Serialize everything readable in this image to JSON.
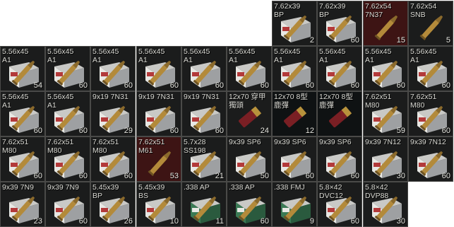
{
  "inventory": {
    "rows": [
      [
        {
          "name": "7.62x39\nBP",
          "qty": "2",
          "art": "box-with-cartridge-icon",
          "tint": "normal"
        },
        {
          "name": "7.62x39\nBP",
          "qty": "60",
          "art": "box-with-cartridge-icon",
          "tint": "normal"
        },
        {
          "name": "7.62x54\n7N37",
          "qty": "15",
          "art": "cartridge-icon",
          "tint": "red"
        },
        {
          "name": "7.62x54\nSNB",
          "qty": "5",
          "art": "cartridge-icon",
          "tint": "normal"
        }
      ],
      [
        {
          "name": "5.56x45\nA1",
          "qty": "54",
          "art": "box-with-cartridge-icon",
          "tint": "normal"
        },
        {
          "name": "5.56x45\nA1",
          "qty": "60",
          "art": "box-with-cartridge-icon",
          "tint": "normal"
        },
        {
          "name": "5.56x45\nA1",
          "qty": "60",
          "art": "box-with-cartridge-icon",
          "tint": "normal"
        },
        {
          "name": "5.56x45\nA1",
          "qty": "60",
          "art": "box-with-cartridge-icon",
          "tint": "normal"
        },
        {
          "name": "5.56x45\nA1",
          "qty": "60",
          "art": "box-with-cartridge-icon",
          "tint": "normal"
        },
        {
          "name": "5.56x45\nA1",
          "qty": "60",
          "art": "box-with-cartridge-icon",
          "tint": "normal"
        },
        {
          "name": "5.56x45\nA1",
          "qty": "60",
          "art": "box-with-cartridge-icon",
          "tint": "normal"
        },
        {
          "name": "5.56x45\nA1",
          "qty": "60",
          "art": "box-with-cartridge-icon",
          "tint": "normal"
        },
        {
          "name": "5.56x45\nA1",
          "qty": "60",
          "art": "box-with-cartridge-icon",
          "tint": "normal"
        },
        {
          "name": "5.56x45\nA1",
          "qty": "60",
          "art": "box-with-cartridge-icon",
          "tint": "normal"
        }
      ],
      [
        {
          "name": "5.56x45\nA1",
          "qty": "60",
          "art": "box-with-cartridge-icon",
          "tint": "normal"
        },
        {
          "name": "5.56x45\nA1",
          "qty": "60",
          "art": "box-with-cartridge-icon",
          "tint": "normal"
        },
        {
          "name": "9x19 7N31",
          "qty": "29",
          "art": "box-with-cartridge-icon",
          "tint": "normal"
        },
        {
          "name": "9x19 7N31",
          "qty": "60",
          "art": "box-with-cartridge-icon",
          "tint": "normal"
        },
        {
          "name": "9x19 7N31",
          "qty": "60",
          "art": "box-with-cartridge-icon",
          "tint": "normal"
        },
        {
          "name": "12x70 穿甲\n獨頭",
          "qty": "24",
          "art": "shotgun-shell-icon",
          "tint": "normal"
        },
        {
          "name": "12x70 8型\n鹿彈",
          "qty": "12",
          "art": "shotgun-shell-icon",
          "tint": "dark"
        },
        {
          "name": "12x70 8型\n鹿彈",
          "qty": "",
          "art": "shotgun-shell-icon",
          "tint": "dark"
        },
        {
          "name": "7.62x51\nM80",
          "qty": "59",
          "art": "box-with-cartridge-icon",
          "tint": "normal"
        },
        {
          "name": "7.62x51\nM80",
          "qty": "60",
          "art": "box-with-cartridge-icon",
          "tint": "normal"
        }
      ],
      [
        {
          "name": "7.62x51\nM80",
          "qty": "60",
          "art": "box-with-cartridge-icon",
          "tint": "normal"
        },
        {
          "name": "7.62x51\nM80",
          "qty": "60",
          "art": "box-with-cartridge-icon",
          "tint": "normal"
        },
        {
          "name": "7.62x51\nM80",
          "qty": "60",
          "art": "box-with-cartridge-icon",
          "tint": "normal"
        },
        {
          "name": "7.62x51\nM61",
          "qty": "53",
          "art": "cartridge-icon",
          "tint": "red"
        },
        {
          "name": "5.7x28\nSS198",
          "qty": "21",
          "art": "box-with-cartridge-icon",
          "tint": "normal"
        },
        {
          "name": "9x39 SP6",
          "qty": "50",
          "art": "box-with-cartridge-icon",
          "tint": "normal"
        },
        {
          "name": "9x39 SP6",
          "qty": "60",
          "art": "box-with-cartridge-icon",
          "tint": "normal"
        },
        {
          "name": "9x39 SP6",
          "qty": "60",
          "art": "box-with-cartridge-icon",
          "tint": "normal"
        },
        {
          "name": "9x39 7N12",
          "qty": "30",
          "art": "box-with-cartridge-icon",
          "tint": "normal"
        },
        {
          "name": "9x39 7N12",
          "qty": "60",
          "art": "box-with-cartridge-icon",
          "tint": "normal"
        }
      ],
      [
        {
          "name": "9x39 7N9",
          "qty": "23",
          "art": "box-with-cartridge-icon",
          "tint": "normal"
        },
        {
          "name": "9x39 7N9",
          "qty": "60",
          "art": "box-with-cartridge-icon",
          "tint": "normal"
        },
        {
          "name": "5.45x39\nBP",
          "qty": "26",
          "art": "box-with-cartridge-icon",
          "tint": "normal"
        },
        {
          "name": "5.45x39\nBS",
          "qty": "10",
          "art": "box-with-cartridge-icon",
          "tint": "normal"
        },
        {
          "name": ".338 AP",
          "qty": "11",
          "art": "green-box-icon",
          "tint": "normal"
        },
        {
          "name": ".338 AP",
          "qty": "60",
          "art": "green-box-icon",
          "tint": "normal"
        },
        {
          "name": ".338 FMJ",
          "qty": "9",
          "art": "green-box-icon",
          "tint": "normal"
        },
        {
          "name": "5.8×42\nDVC12",
          "qty": "60",
          "art": "box-with-cartridge-icon",
          "tint": "normal"
        },
        {
          "name": "5.8×42\nDVP88",
          "qty": "30",
          "art": "box-with-cartridge-icon",
          "tint": "normal"
        }
      ]
    ]
  },
  "colors": {
    "cell_bg": "#1b1c1c",
    "cell_border": "#4a4a48",
    "text": "#d8d8d2",
    "red_tint": "#3d1414"
  }
}
